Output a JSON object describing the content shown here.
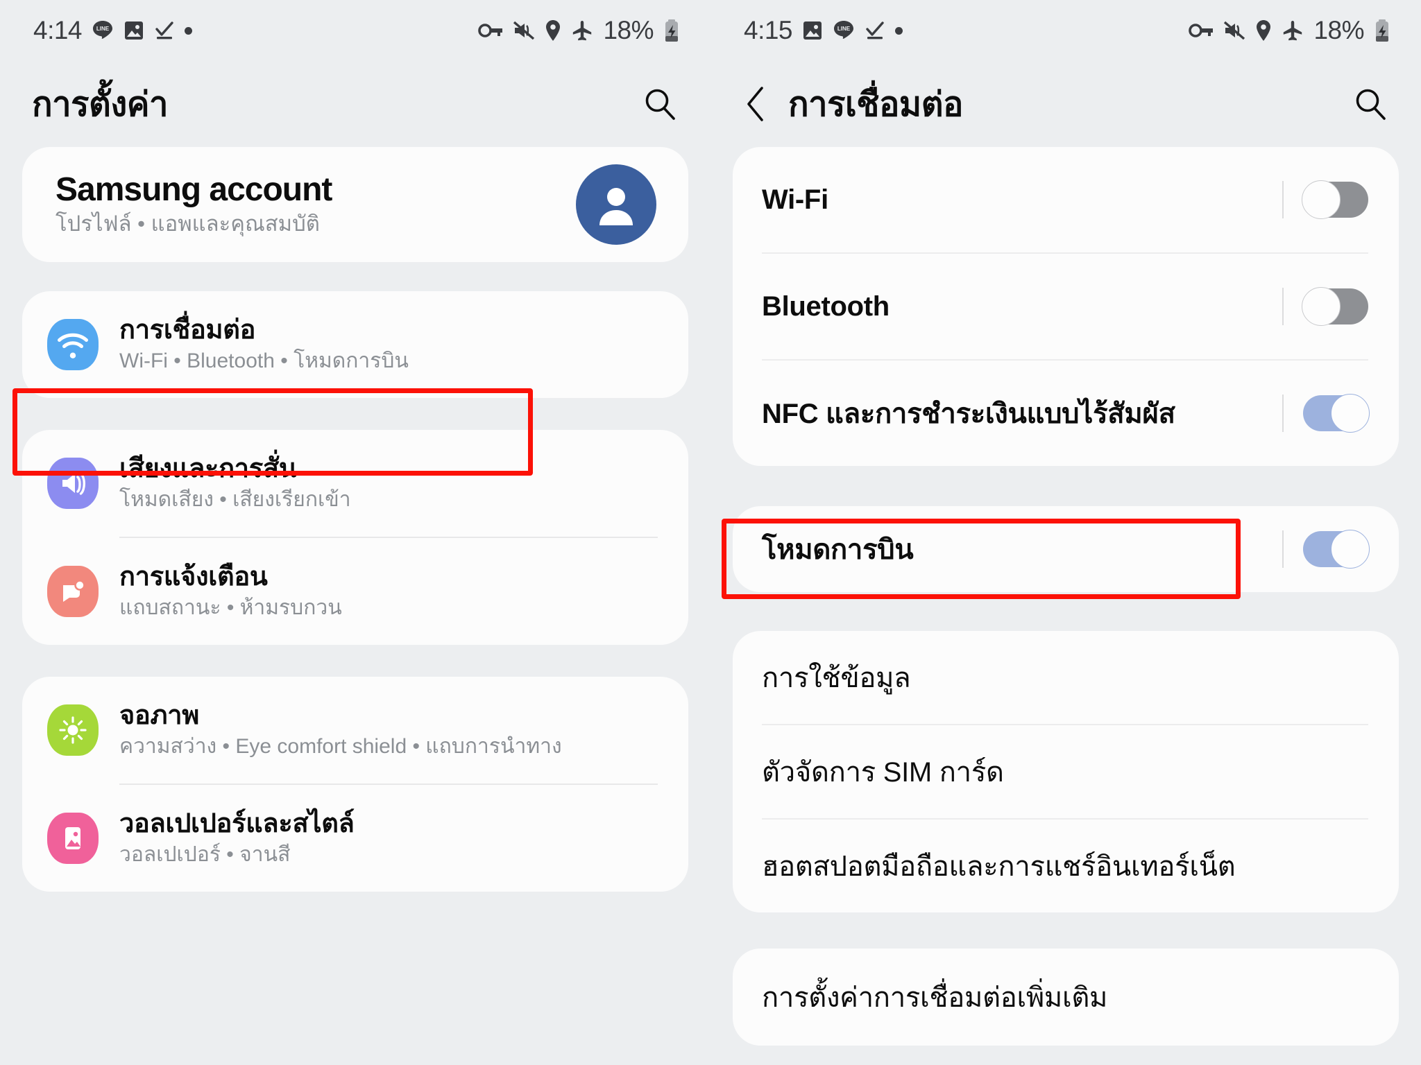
{
  "left": {
    "statusbar": {
      "time": "4:14",
      "left_icons": [
        "line-icon",
        "image-icon",
        "checkmark-underline-icon",
        "dot-icon"
      ],
      "right_icons": [
        "vpn-key-icon",
        "mute-icon",
        "location-icon",
        "airplane-icon"
      ],
      "battery_percent": "18%",
      "battery_icon": "battery-charging-icon"
    },
    "appbar": {
      "title": "การตั้งค่า",
      "search_icon": "search-icon"
    },
    "account": {
      "title": "Samsung account",
      "subtitle": "โปรไฟล์ • แอพและคุณสมบัติ",
      "avatar_icon": "person-avatar-icon",
      "avatar_color": "#3b5f9e"
    },
    "items": [
      {
        "title": "การเชื่อมต่อ",
        "subtitle": "Wi-Fi • Bluetooth • โหมดการบิน",
        "icon": "wifi-icon",
        "icon_color": "#54a8f0",
        "highlighted": true
      },
      {
        "title": "เสียงและการสั่น",
        "subtitle": "โหมดเสียง • เสียงเรียกเข้า",
        "icon": "sound-volume-icon",
        "icon_color": "#8c8cf0",
        "highlighted": false
      },
      {
        "title": "การแจ้งเตือน",
        "subtitle": "แถบสถานะ • ห้ามรบกวน",
        "icon": "notification-bubble-icon",
        "icon_color": "#f2887d",
        "highlighted": false
      },
      {
        "title": "จอภาพ",
        "subtitle": "ความสว่าง • Eye comfort shield • แถบการนำทาง",
        "icon": "brightness-sun-icon",
        "icon_color": "#a5d839",
        "highlighted": false
      },
      {
        "title": "วอลเปเปอร์และสไตล์",
        "subtitle": "วอลเปเปอร์ • จานสี",
        "icon": "wallpaper-image-icon",
        "icon_color": "#f0619a",
        "highlighted": false
      }
    ]
  },
  "right": {
    "statusbar": {
      "time": "4:15",
      "left_icons": [
        "image-icon",
        "line-icon",
        "checkmark-underline-icon",
        "dot-icon"
      ],
      "right_icons": [
        "vpn-key-icon",
        "mute-icon",
        "location-icon",
        "airplane-icon"
      ],
      "battery_percent": "18%",
      "battery_icon": "battery-charging-icon"
    },
    "appbar": {
      "title": "การเชื่อมต่อ",
      "back_icon": "back-chevron-icon",
      "search_icon": "search-icon"
    },
    "toggle_group": [
      {
        "label": "Wi-Fi",
        "state": "off"
      },
      {
        "label": "Bluetooth",
        "state": "off"
      },
      {
        "label": "NFC และการชำระเงินแบบไร้สัมผัส",
        "state": "on"
      }
    ],
    "airplane": {
      "label": "โหมดการบิน",
      "state": "on",
      "highlighted": true
    },
    "link_group": [
      {
        "label": "การใช้ข้อมูล"
      },
      {
        "label": "ตัวจัดการ SIM การ์ด"
      },
      {
        "label": "ฮอตสปอตมือถือและการแชร์อินเทอร์เน็ต"
      }
    ],
    "more_group": [
      {
        "label": "การตั้งค่าการเชื่อมต่อเพิ่มเติม"
      }
    ]
  },
  "highlight_color": "#fc1107"
}
